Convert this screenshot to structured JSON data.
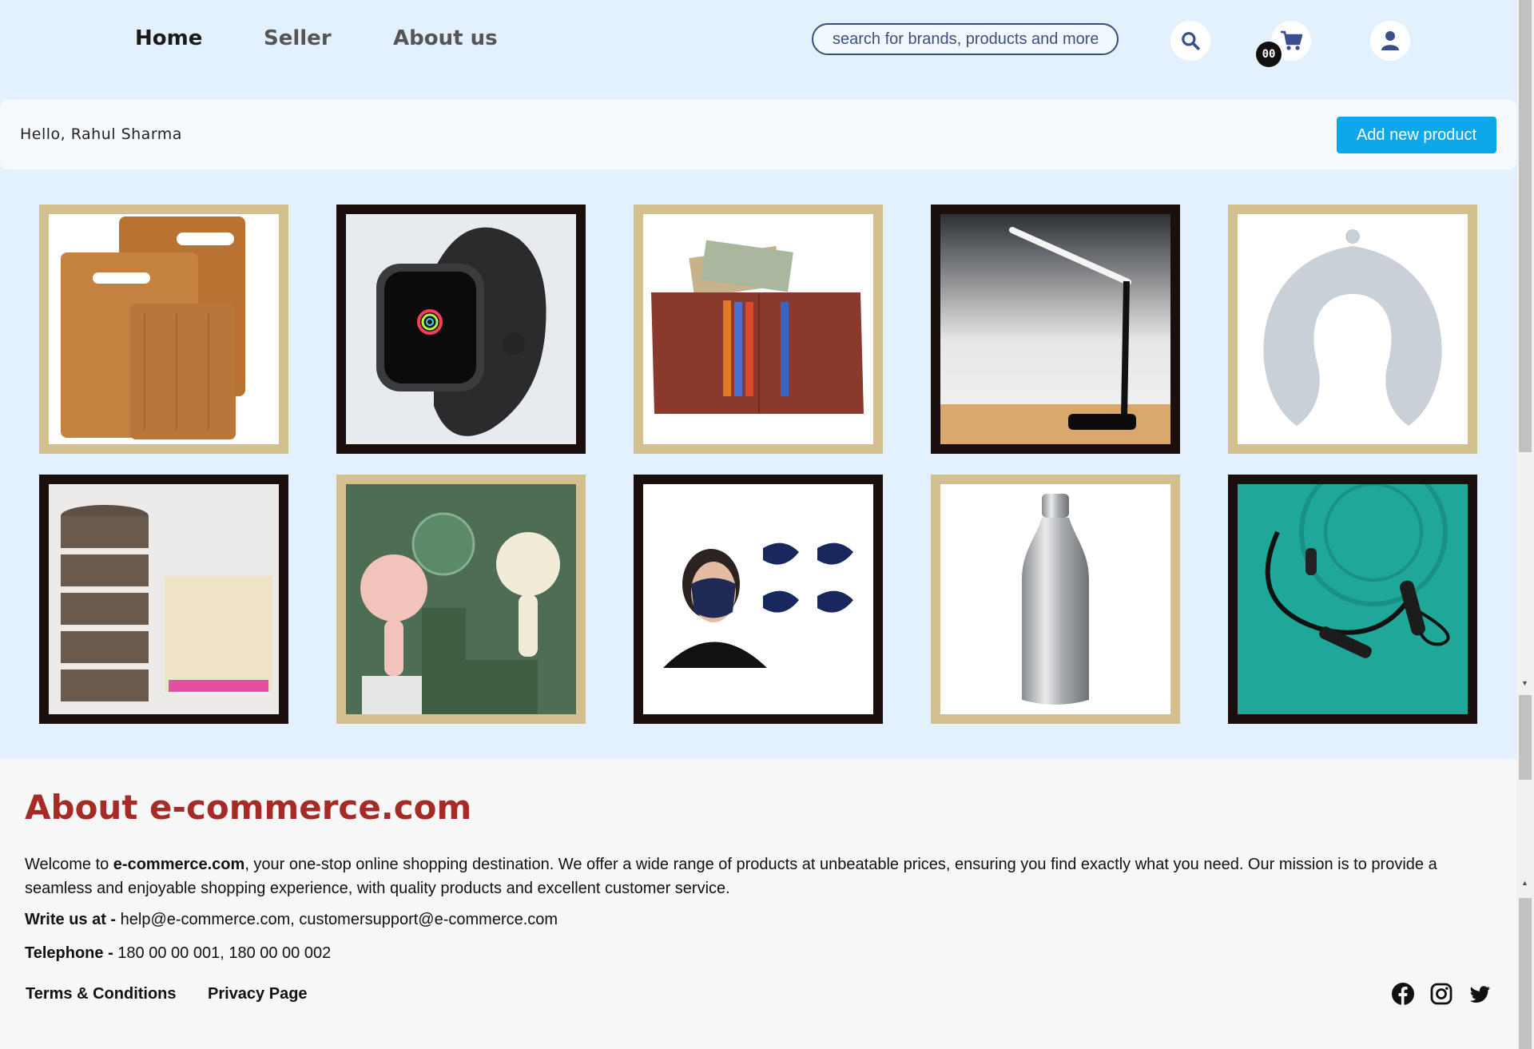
{
  "nav": {
    "links": [
      "Home",
      "Seller",
      "About us"
    ],
    "search_placeholder": "search for brands, products and more",
    "cart_count": "00"
  },
  "greeting": {
    "text": "Hello, Rahul Sharma",
    "add_button": "Add new product"
  },
  "products": [
    {
      "icon": "cutting-boards",
      "frame": "gold"
    },
    {
      "icon": "smartwatch",
      "frame": "dark"
    },
    {
      "icon": "leather-wallet",
      "frame": "gold"
    },
    {
      "icon": "desk-lamp",
      "frame": "dark"
    },
    {
      "icon": "neck-pillow",
      "frame": "gold"
    },
    {
      "icon": "cookware-set",
      "frame": "dark"
    },
    {
      "icon": "handheld-fan",
      "frame": "gold"
    },
    {
      "icon": "face-masks",
      "frame": "dark"
    },
    {
      "icon": "steel-bottle",
      "frame": "gold"
    },
    {
      "icon": "neckband-earphones",
      "frame": "dark"
    }
  ],
  "footer": {
    "title": "About e-commerce.com",
    "intro_prefix": "Welcome to ",
    "intro_brand": "e-commerce.com",
    "intro_rest": ", your one-stop online shopping destination. We offer a wide range of products at unbeatable prices, ensuring you find exactly what you need. Our mission is to provide a seamless and enjoyable shopping experience, with quality products and excellent customer service.",
    "write_label": "Write us at -",
    "write_value": " help@e-commerce.com, customersupport@e-commerce.com",
    "phone_label": "Telephone -",
    "phone_value": " 180 00 00 001, 180 00 00 002",
    "links": [
      "Terms & Conditions",
      "Privacy Page"
    ],
    "social": [
      "facebook-icon",
      "instagram-icon",
      "twitter-icon"
    ]
  },
  "colors": {
    "page_bg": "#e3f0fd",
    "accent_button": "#0da7ea",
    "title_red": "#a62b27",
    "frame_gold": "#d4bf8f",
    "frame_dark": "#1a0f0c"
  }
}
